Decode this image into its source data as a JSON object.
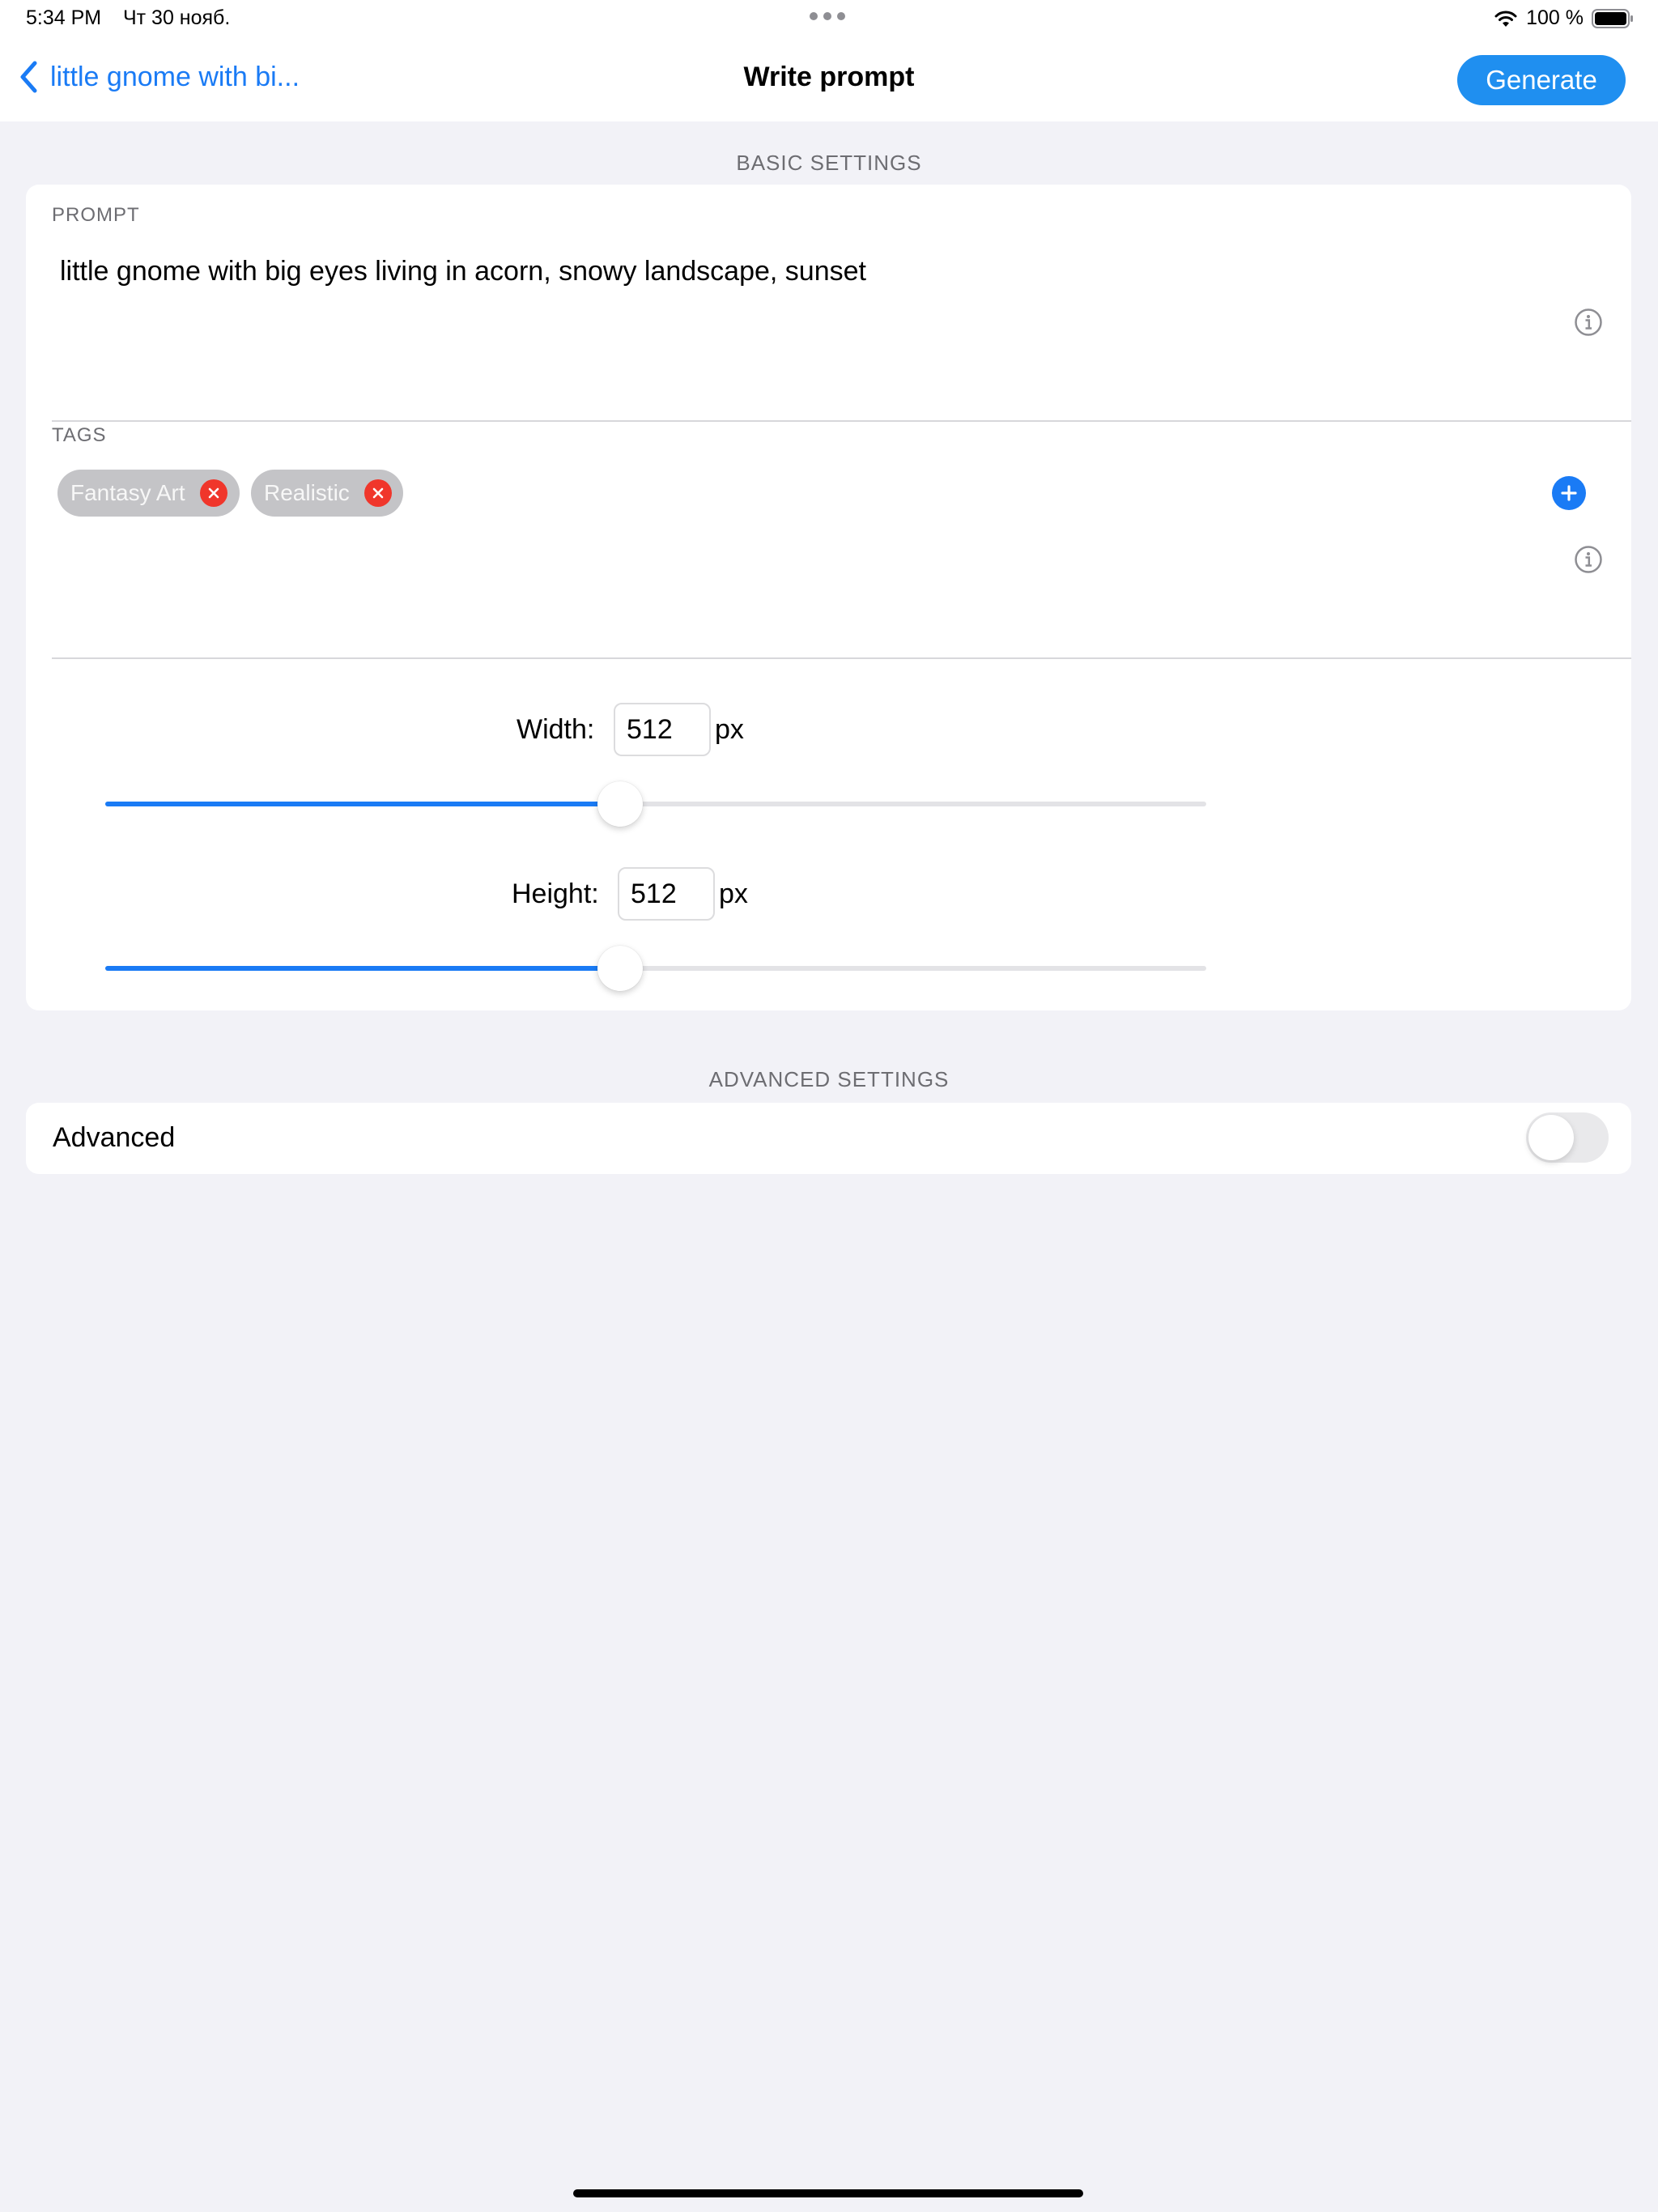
{
  "status_bar": {
    "time": "5:34 PM",
    "date": "Чт 30 нояб.",
    "battery": "100 %"
  },
  "nav": {
    "back_label": "little gnome with bi...",
    "title": "Write prompt",
    "generate_label": "Generate"
  },
  "basic_settings": {
    "header": "BASIC SETTINGS",
    "prompt_label": "PROMPT",
    "prompt_text": "little gnome with big eyes living in acorn, snowy landscape, sunset",
    "tags_label": "TAGS",
    "tags": [
      "Fantasy Art",
      "Realistic"
    ],
    "width": {
      "label": "Width:",
      "value": "512",
      "unit": "px",
      "slider_fraction": 0.468
    },
    "height": {
      "label": "Height:",
      "value": "512",
      "unit": "px",
      "slider_fraction": 0.468
    }
  },
  "advanced_settings": {
    "header": "ADVANCED SETTINGS",
    "advanced_label": "Advanced",
    "advanced_on": false
  },
  "colors": {
    "accent": "#1a7bf5",
    "generate_bg": "#1f8ff0",
    "remove_tag": "#f0362b",
    "background": "#f2f2f7"
  }
}
